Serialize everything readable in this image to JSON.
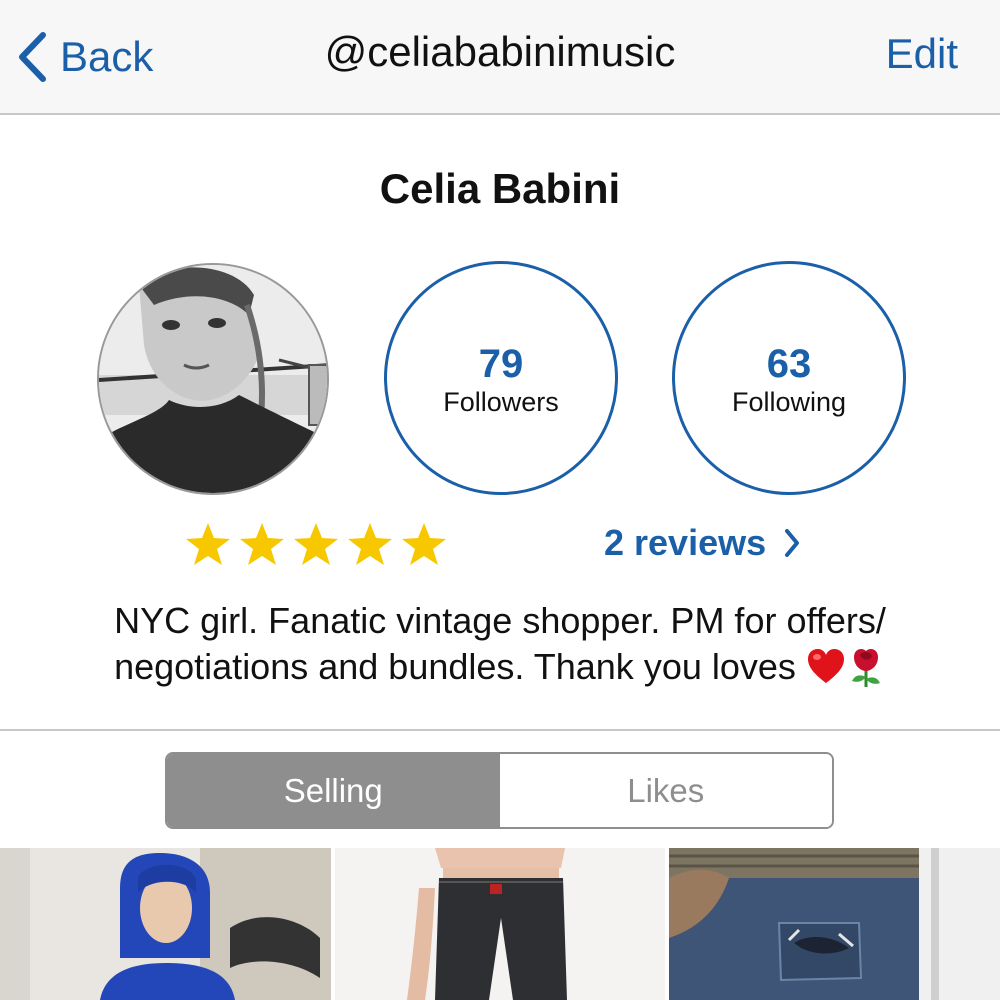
{
  "navbar": {
    "back_label": "Back",
    "title": "@celiababinimusic",
    "edit_label": "Edit",
    "accent_color": "#1a5fa8"
  },
  "profile": {
    "name": "Celia Babini",
    "avatar_icon": "profile-photo",
    "followers": {
      "count": "79",
      "label": "Followers"
    },
    "following": {
      "count": "63",
      "label": "Following"
    },
    "rating": {
      "stars": 5,
      "max": 5,
      "star_color": "#f7c800"
    },
    "reviews_label": "2 reviews",
    "bio_line1": "NYC girl. Fanatic vintage shopper. PM for offers/",
    "bio_line2": "negotiations and bundles. Thank you loves",
    "bio_emojis": [
      "red-heart",
      "rose"
    ]
  },
  "tabs": {
    "selling_label": "Selling",
    "likes_label": "Likes",
    "active": "Selling"
  },
  "listings": [
    {
      "icon": "listing-photo-hoodie"
    },
    {
      "icon": "listing-photo-jeans"
    },
    {
      "icon": "listing-photo-ripped-denim"
    }
  ]
}
